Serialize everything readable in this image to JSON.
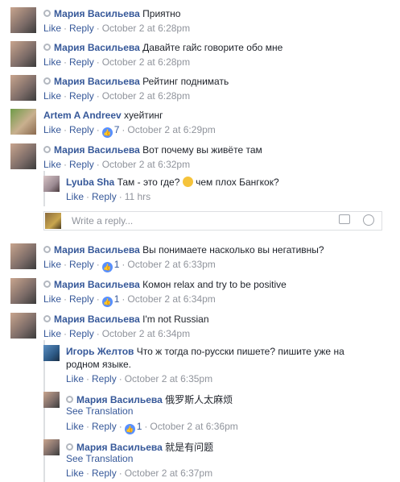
{
  "actions": {
    "like": "Like",
    "reply": "Reply",
    "see_translation": "See Translation"
  },
  "comments": [
    {
      "author": "Мария Васильева",
      "text": "Приятно",
      "time": "October 2 at 6:28pm"
    },
    {
      "author": "Мария Васильева",
      "text": "Давайте гайс говорите обо мне",
      "time": "October 2 at 6:28pm"
    },
    {
      "author": "Мария Васильева",
      "text": "Рейтинг поднимать",
      "time": "October 2 at 6:28pm"
    },
    {
      "author": "Artem A Andreev",
      "text": "хуейтинг",
      "likes": "7",
      "time": "October 2 at 6:29pm"
    },
    {
      "author": "Мария Васильева",
      "text": "Вот почему вы живёте там",
      "time": "October 2 at 6:32pm"
    },
    {
      "author": "Мария Васильева",
      "text": "Вы понимаете насколько вы негативны?",
      "likes": "1",
      "time": "October 2 at 6:33pm"
    },
    {
      "author": "Мария Васильева",
      "text": "Комон relax and try to be positive",
      "likes": "1",
      "time": "October 2 at 6:34pm"
    },
    {
      "author": "Мария Васильева",
      "text": "I'm not Russian",
      "time": "October 2 at 6:34pm"
    }
  ],
  "reply_a": {
    "author": "Lyuba Sha",
    "text_before": "Там - это где?",
    "text_after": "чем плох Бангкок?",
    "time": "11 hrs"
  },
  "reply_box": {
    "placeholder": "Write a reply..."
  },
  "reply_b": {
    "author": "Игорь Желтов",
    "text1": "Что ж тогда по-русски пишете? пишите уже на",
    "text2": "родном языке.",
    "time": "October 2 at 6:35pm"
  },
  "reply_c": {
    "author": "Мария Васильева",
    "text": "俄罗斯人太麻烦",
    "likes": "1",
    "time": "October 2 at 6:36pm"
  },
  "reply_d": {
    "author": "Мария Васильева",
    "text": "就是有问题",
    "time": "October 2 at 6:37pm"
  }
}
